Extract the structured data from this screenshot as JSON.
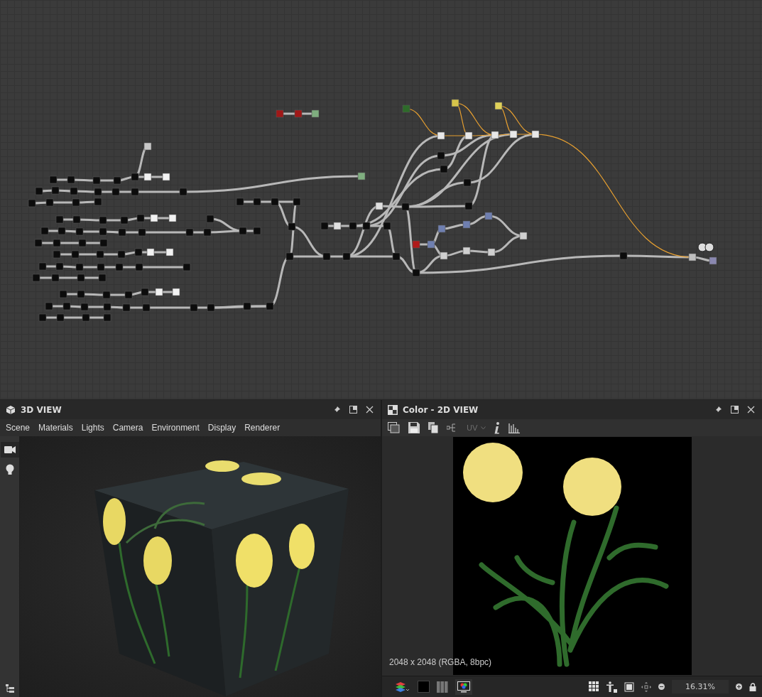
{
  "viewport_3d": {
    "title": "3D VIEW",
    "menu": [
      "Scene",
      "Materials",
      "Lights",
      "Camera",
      "Environment",
      "Display",
      "Renderer"
    ],
    "side_tools": [
      {
        "kind": "camera",
        "selected": true
      },
      {
        "kind": "light",
        "selected": false
      }
    ]
  },
  "viewport_2d": {
    "title": "Color - 2D VIEW",
    "uv_label": "UV",
    "uv_disabled": true,
    "info": "2048 x 2048 (RGBA, 8bpc)",
    "zoom": "16.31%"
  }
}
